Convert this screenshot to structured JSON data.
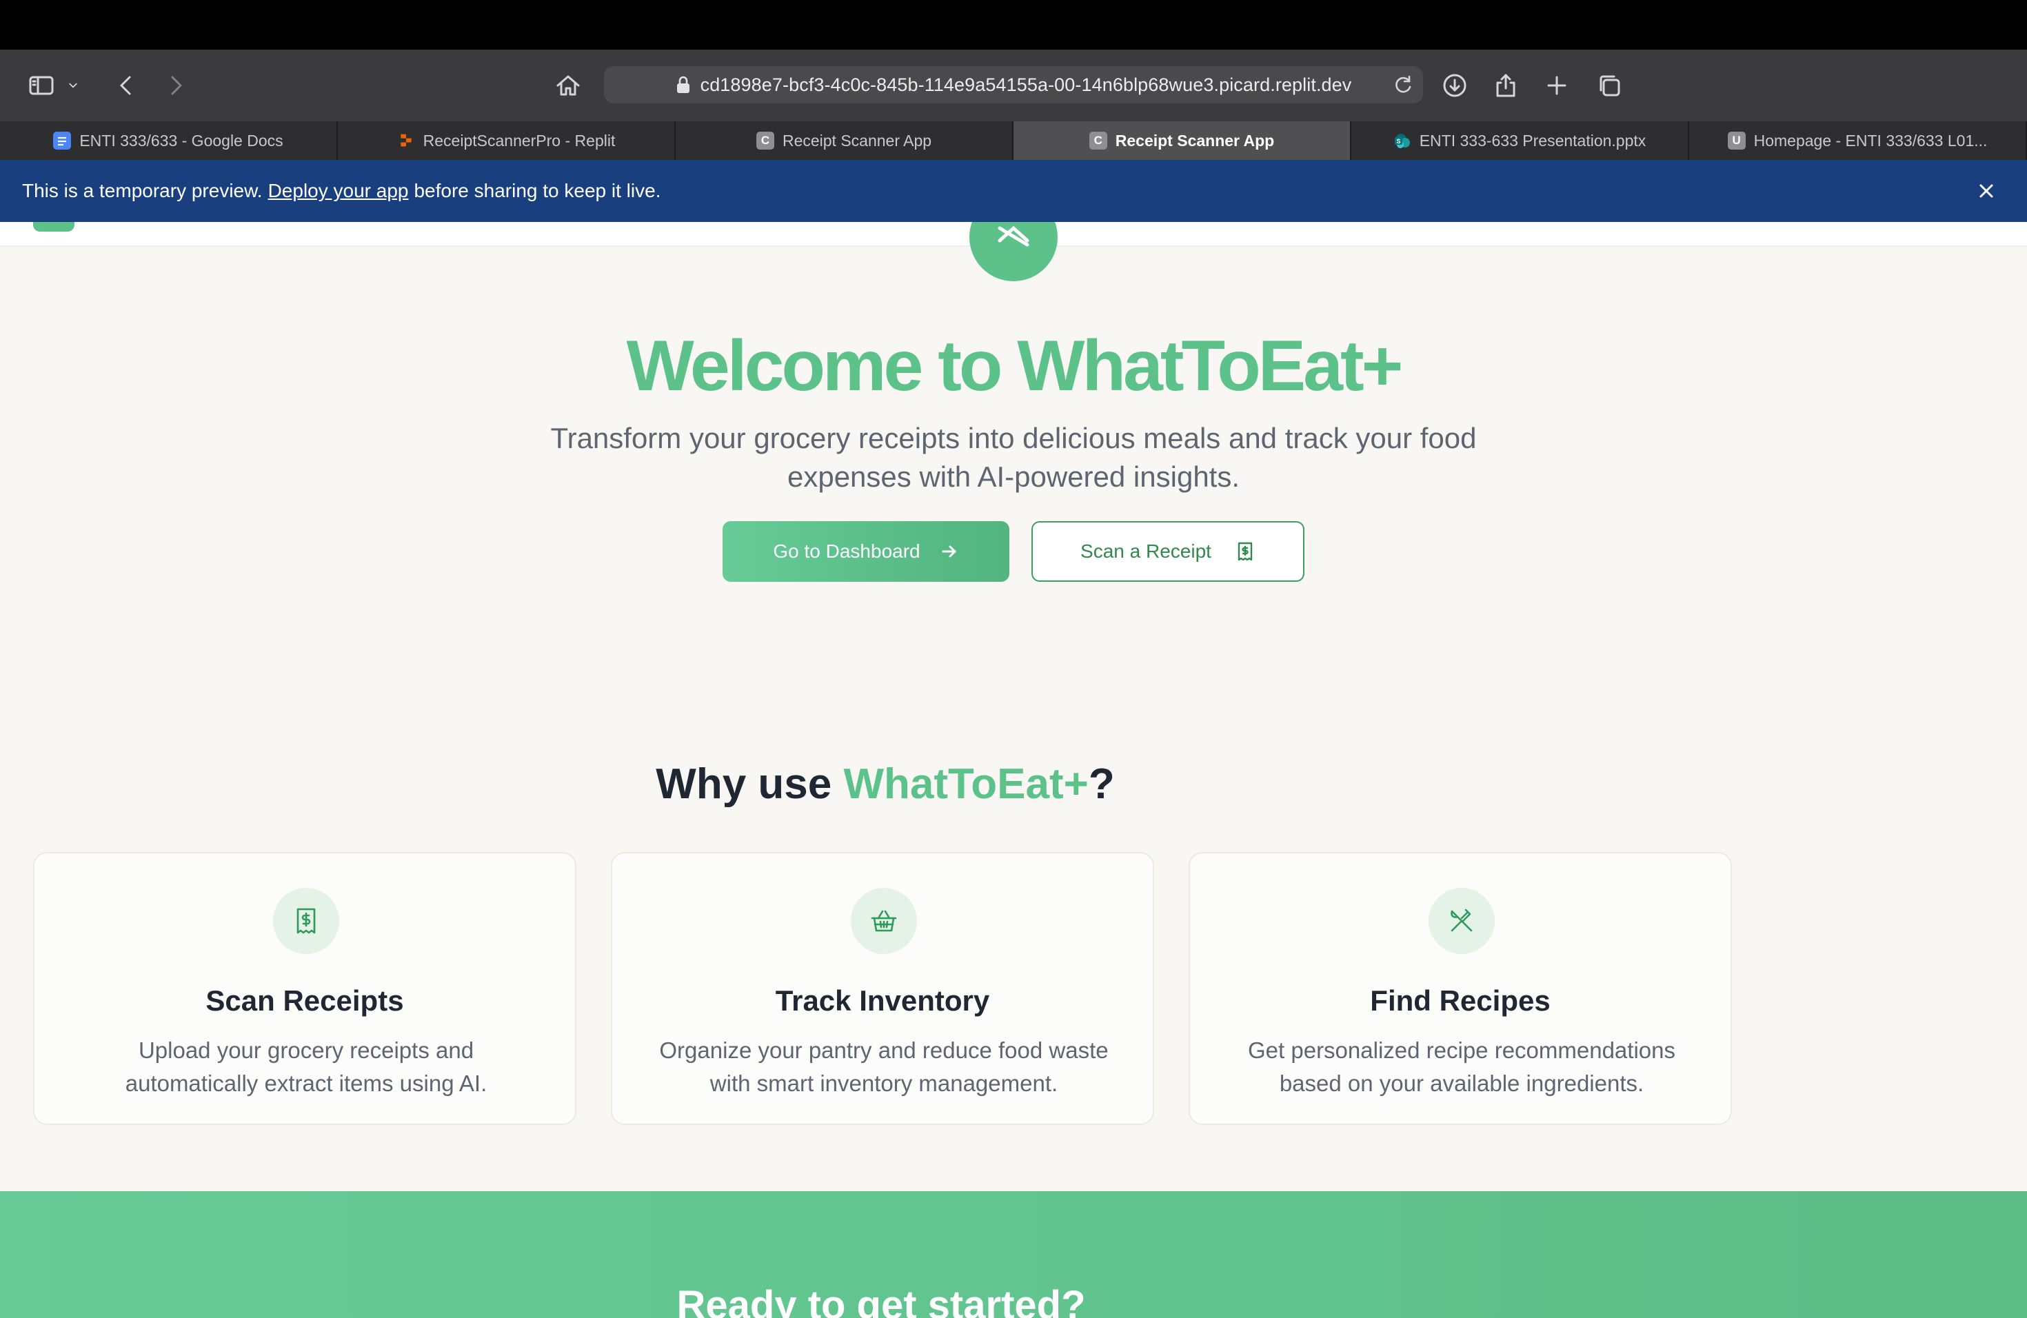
{
  "browser": {
    "url": "cd1898e7-bcf3-4c0c-845b-114e9a54155a-00-14n6blp68wue3.picard.replit.dev",
    "tabs": [
      {
        "label": "ENTI 333/633 - Google Docs",
        "favicon": "docs-icon",
        "active": false
      },
      {
        "label": "ReceiptScannerPro - Replit",
        "favicon": "replit-icon",
        "active": false
      },
      {
        "label": "Receipt Scanner App",
        "favicon": "C",
        "active": false
      },
      {
        "label": "Receipt Scanner App",
        "favicon": "C",
        "active": true
      },
      {
        "label": "ENTI 333-633 Presentation.pptx",
        "favicon": "sharepoint-icon",
        "active": false
      },
      {
        "label": "Homepage - ENTI 333/633 L01...",
        "favicon": "U",
        "active": false
      }
    ]
  },
  "banner": {
    "text_before": "This is a temporary preview.",
    "link": "Deploy your app",
    "text_after": "before sharing to keep it live."
  },
  "hero": {
    "title": "Welcome to WhatToEat+",
    "subtitle": "Transform your grocery receipts into delicious meals and track your food expenses with AI-powered insights.",
    "primary_button": "Go to Dashboard",
    "secondary_button": "Scan a Receipt"
  },
  "why": {
    "prefix": "Why use ",
    "brand": "WhatToEat+",
    "suffix": "?"
  },
  "features": [
    {
      "title": "Scan Receipts",
      "description": "Upload your grocery receipts and automatically extract items using AI.",
      "icon": "receipt-icon"
    },
    {
      "title": "Track Inventory",
      "description": "Organize your pantry and reduce food waste with smart inventory management.",
      "icon": "basket-icon"
    },
    {
      "title": "Find Recipes",
      "description": "Get personalized recipe recommendations based on your available ingredients.",
      "icon": "utensils-crossed-icon"
    }
  ],
  "cta": {
    "title": "Ready to get started?"
  },
  "colors": {
    "accent": "#5cc28a",
    "banner": "#1a3f7e",
    "dark_text": "#1f2733"
  }
}
